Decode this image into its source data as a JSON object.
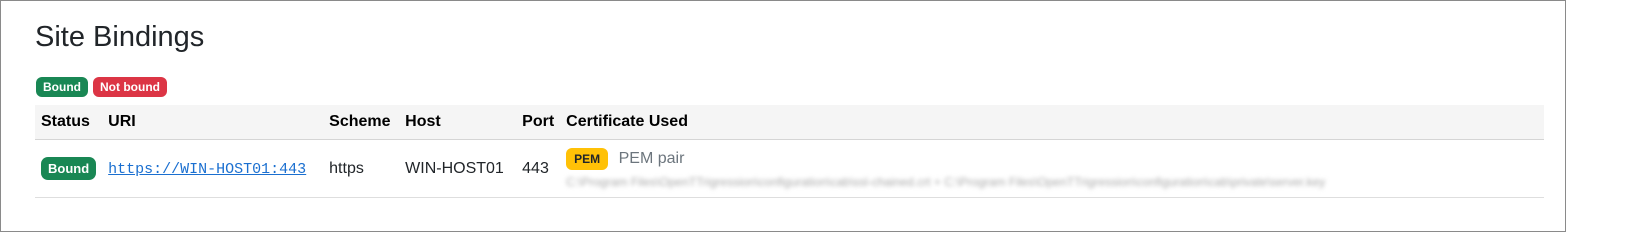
{
  "page": {
    "title": "Site Bindings"
  },
  "legend": {
    "bound_label": "Bound",
    "not_bound_label": "Not bound"
  },
  "colors": {
    "bound": "#198754",
    "not_bound": "#dc3545",
    "pem": "#ffc107",
    "link": "#1a6fd0"
  },
  "table": {
    "columns": [
      "Status",
      "URI",
      "Scheme",
      "Host",
      "Port",
      "Certificate Used"
    ],
    "rows": [
      {
        "status": "Bound",
        "uri": "https://WIN-HOST01:443",
        "scheme": "https",
        "host": "WIN-HOST01",
        "port": "443",
        "cert_badge": "PEM",
        "cert_label": "PEM pair",
        "cert_path": "C:\\Program Files\\OpenTTrigression\\configuration\\cab\\ssl-chained.crt + C:\\Program Files\\OpenTTrigression\\configuration\\cab\\private\\server.key"
      }
    ]
  }
}
